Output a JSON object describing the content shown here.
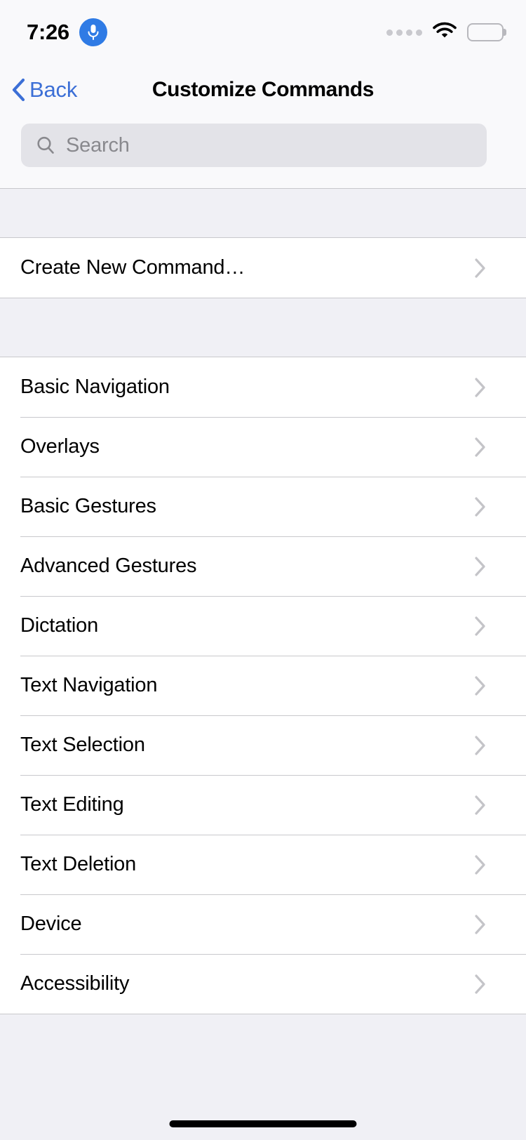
{
  "status_bar": {
    "time": "7:26",
    "mic_icon": "microphone-icon",
    "signal_dots": 4,
    "wifi_icon": "wifi-icon",
    "battery_icon": "battery-full-icon",
    "accent_color": "#2f7be5"
  },
  "nav": {
    "back_label": "Back",
    "back_icon": "chevron-left-icon",
    "title": "Customize Commands",
    "tint_color": "#3c6fd6"
  },
  "search": {
    "placeholder": "Search",
    "value": "",
    "icon": "search-icon"
  },
  "sections": [
    {
      "name": "create",
      "rows": [
        {
          "label": "Create New Command…",
          "accessory": "chevron-right-icon"
        }
      ]
    },
    {
      "name": "categories",
      "rows": [
        {
          "label": "Basic Navigation",
          "accessory": "chevron-right-icon"
        },
        {
          "label": "Overlays",
          "accessory": "chevron-right-icon"
        },
        {
          "label": "Basic Gestures",
          "accessory": "chevron-right-icon"
        },
        {
          "label": "Advanced Gestures",
          "accessory": "chevron-right-icon"
        },
        {
          "label": "Dictation",
          "accessory": "chevron-right-icon"
        },
        {
          "label": "Text Navigation",
          "accessory": "chevron-right-icon"
        },
        {
          "label": "Text Selection",
          "accessory": "chevron-right-icon"
        },
        {
          "label": "Text Editing",
          "accessory": "chevron-right-icon"
        },
        {
          "label": "Text Deletion",
          "accessory": "chevron-right-icon"
        },
        {
          "label": "Device",
          "accessory": "chevron-right-icon"
        },
        {
          "label": "Accessibility",
          "accessory": "chevron-right-icon"
        }
      ]
    }
  ],
  "home_indicator": "home-indicator",
  "colors": {
    "background": "#ffffff",
    "grouped_background": "#f0f0f5",
    "chrome": "#f9f9fb",
    "separator": "#c8c8cc",
    "chevron": "#c4c4c8",
    "search_fill": "#e3e3e8",
    "placeholder_text": "#89898e"
  }
}
